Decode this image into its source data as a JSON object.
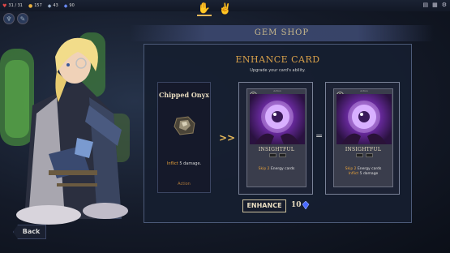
{
  "topbar": {
    "health": "31 / 31",
    "gold": "157",
    "gems_a": "43",
    "gems_b": "90",
    "right_icons": [
      "deck-icon",
      "map-icon",
      "settings-icon"
    ]
  },
  "shop": {
    "header": "GEM SHOP",
    "title": "ENHANCE CARD",
    "subtitle": "Upgrade your card's ability."
  },
  "source_card": {
    "name": "Chipped Onyx",
    "desc_prefix": "Inflict",
    "desc_value": "5",
    "desc_suffix": "damage.",
    "type": "Action"
  },
  "target_card": {
    "cost": "0",
    "name": "INSIGHTFUL",
    "effect_prefix": "Skip",
    "effect_value": "2",
    "effect_suffix": "Energy cards",
    "tag": "Action"
  },
  "result_card": {
    "cost": "0",
    "name": "INSIGHTFUL",
    "line1_prefix": "Skip",
    "line1_value": "2",
    "line1_suffix": "Energy cards",
    "line2_prefix": "Inflict",
    "line2_value": "5",
    "line2_suffix": "damage",
    "tag": "Action"
  },
  "action": {
    "enhance_label": "ENHANCE",
    "cost": "10"
  },
  "nav": {
    "back_label": "Back"
  },
  "colors": {
    "accent": "#e6b85a",
    "highlight": "#e8a23a",
    "panel": "#161e30"
  }
}
